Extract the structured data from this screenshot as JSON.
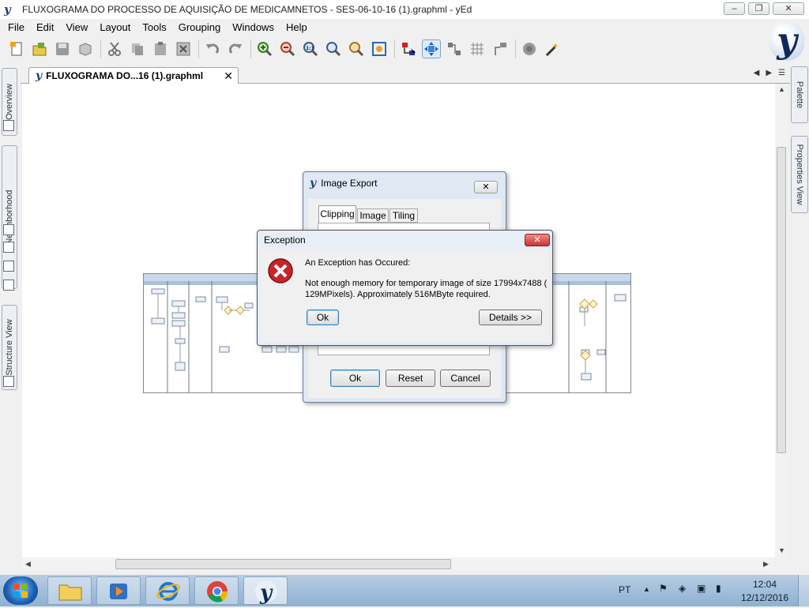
{
  "window": {
    "title": "FLUXOGRAMA DO PROCESSO DE AQUISIÇÃO DE MEDICAMNETOS - SES-06-10-16 (1).graphml - yEd",
    "min": "‒",
    "max": "❐",
    "close": "✕"
  },
  "menu": [
    "File",
    "Edit",
    "View",
    "Layout",
    "Tools",
    "Grouping",
    "Windows",
    "Help"
  ],
  "toolbar_icons": [
    "new-icon",
    "open-icon",
    "save-icon",
    "save-as-icon",
    "cut-icon",
    "copy-icon",
    "paste-icon",
    "delete-icon",
    "undo-icon",
    "redo-icon",
    "zoom-in-icon",
    "zoom-out-icon",
    "zoom-100-icon",
    "zoom-area-icon",
    "zoom-fit-icon",
    "fit-content-icon",
    "edit-mode-icon",
    "navigate-mode-icon",
    "orthogonal-edges-icon",
    "grid-icon",
    "snap-icon",
    "layout-icon",
    "wizard-icon"
  ],
  "document_tab": {
    "label": "FLUXOGRAMA DO...16 (1).graphml",
    "close": "✕"
  },
  "left_panels": [
    "Overview",
    "Neighborhood",
    "Structure View"
  ],
  "right_panels": [
    "Palette",
    "Properties View"
  ],
  "image_export": {
    "title": "Image Export",
    "close": "✕",
    "tabs": [
      "Clipping",
      "Image",
      "Tiling"
    ],
    "ok": "Ok",
    "reset": "Reset",
    "cancel": "Cancel"
  },
  "exception": {
    "title": "Exception",
    "close": "✕",
    "heading": "An Exception has Occured:",
    "message_line1": "Not enough memory for temporary image of size 17994x7488 (",
    "message_line2": "129MPixels).  Approximately 516MByte required.",
    "ok": "Ok",
    "details": "Details >>"
  },
  "tray": {
    "language": "PT",
    "time": "12:04",
    "date": "12/12/2016"
  },
  "colors": {
    "accent": "#1b3f7a",
    "error_red": "#c8242a",
    "selected_tool": "#dcebfb"
  }
}
